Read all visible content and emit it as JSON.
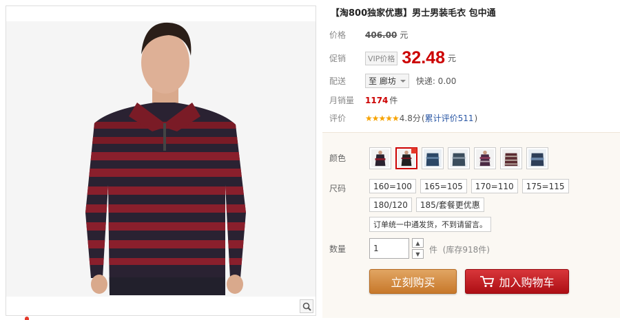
{
  "product": {
    "title": "【淘800独家优惠】男士男装毛衣 包中通"
  },
  "price": {
    "label": "价格",
    "original": "406.00",
    "unit": "元"
  },
  "promo": {
    "label": "促销",
    "vip_tag": "VIP价格",
    "price": "32.48",
    "unit": "元"
  },
  "delivery": {
    "label": "配送",
    "destination": "至 廊坊",
    "shipping": "快递: 0.00"
  },
  "monthly_sales": {
    "label": "月销量",
    "count": "1174",
    "unit": "件"
  },
  "rating": {
    "label": "评价",
    "stars": "★★★★★",
    "score": "4.8分",
    "open_paren": "(",
    "review_link": "累计评价511",
    "close_paren": ")"
  },
  "options": {
    "color_label": "颜色",
    "colors": [
      {
        "name": "color-1",
        "fill": "#2a2230",
        "accent": "#8a1c2a"
      },
      {
        "name": "color-2",
        "fill": "#222",
        "accent": "#7a1320"
      },
      {
        "name": "color-3",
        "fill": "#2c4766",
        "accent": "#5f7fa0"
      },
      {
        "name": "color-4",
        "fill": "#3a4c5c",
        "accent": "#7e8e9c"
      },
      {
        "name": "color-5",
        "fill": "#4a2a44",
        "accent": "#8a3a5a"
      },
      {
        "name": "color-6",
        "fill": "#5a2a30",
        "accent": "#b9a9a0"
      },
      {
        "name": "color-7",
        "fill": "#2e3e58",
        "accent": "#6a86a8"
      }
    ],
    "size_label": "尺码",
    "sizes": [
      "160=100",
      "165=105",
      "170=110",
      "175=115",
      "180/120",
      "185/套餐更优惠"
    ],
    "note": "订单统一中通发货，不到请留言。",
    "qty_label": "数量",
    "qty_value": "1",
    "qty_unit": "件",
    "stock": "(库存918件)"
  },
  "actions": {
    "buy_now": "立刻购买",
    "add_to_cart": "加入购物车"
  },
  "colors": {
    "price_red": "#cc0000",
    "buy_orange": "#d58b3f",
    "cart_red": "#c11c22",
    "link_blue": "#2a57a5",
    "star_orange": "#f7a300"
  }
}
